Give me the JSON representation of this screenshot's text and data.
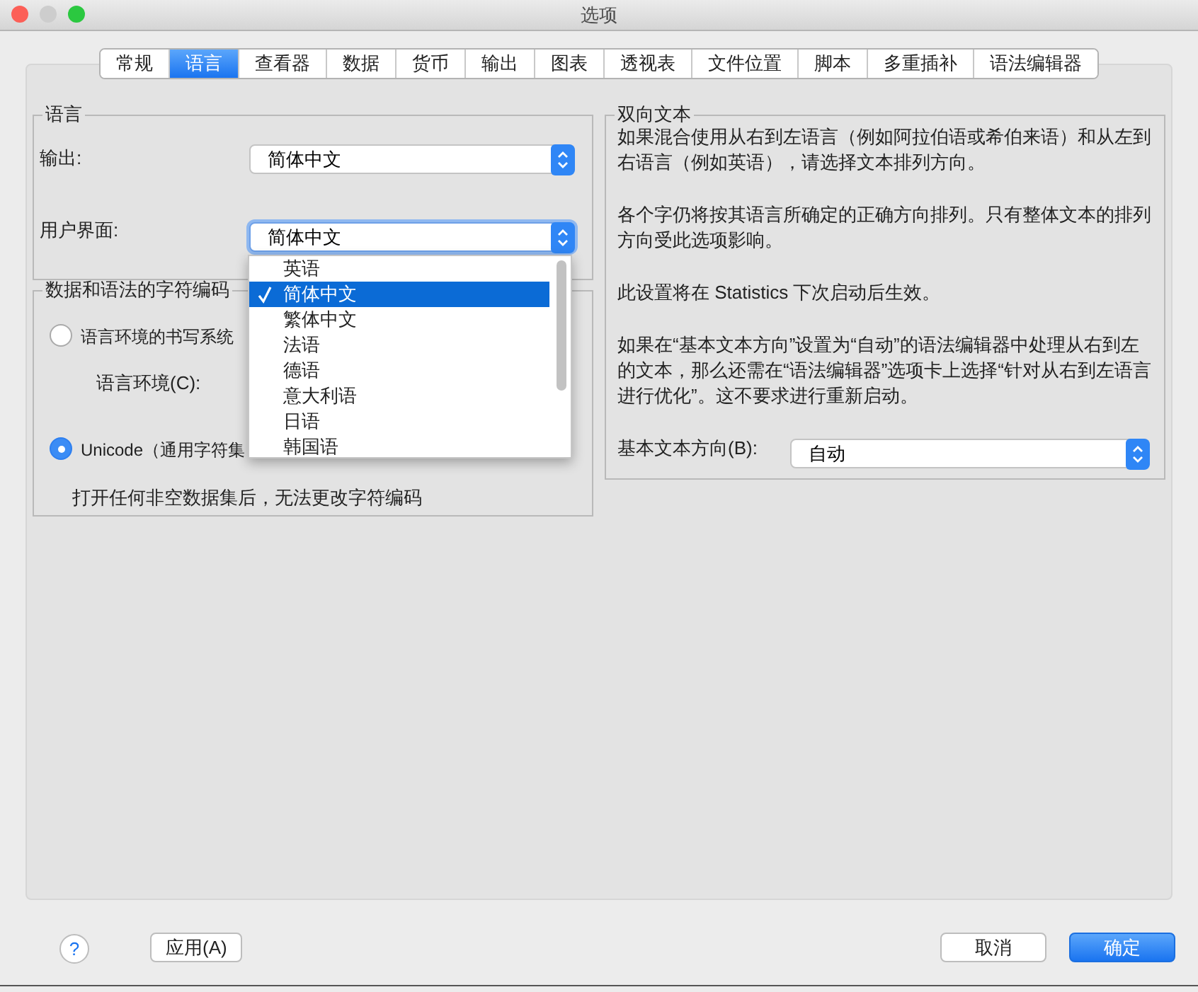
{
  "window": {
    "title": "选项"
  },
  "tabs": [
    {
      "label": "常规",
      "selected": false
    },
    {
      "label": "语言",
      "selected": true
    },
    {
      "label": "查看器",
      "selected": false
    },
    {
      "label": "数据",
      "selected": false
    },
    {
      "label": "货币",
      "selected": false
    },
    {
      "label": "输出",
      "selected": false
    },
    {
      "label": "图表",
      "selected": false
    },
    {
      "label": "透视表",
      "selected": false
    },
    {
      "label": "文件位置",
      "selected": false
    },
    {
      "label": "脚本",
      "selected": false
    },
    {
      "label": "多重插补",
      "selected": false
    },
    {
      "label": "语法编辑器",
      "selected": false
    }
  ],
  "language_group": {
    "title": "语言",
    "output": {
      "label": "输出:",
      "value": "简体中文"
    },
    "user_interface": {
      "label": "用户界面:",
      "value": "简体中文",
      "expanded": true
    }
  },
  "dropdown_items": [
    {
      "label": "英语",
      "selected": false
    },
    {
      "label": "简体中文",
      "selected": true
    },
    {
      "label": "繁体中文",
      "selected": false
    },
    {
      "label": "法语",
      "selected": false
    },
    {
      "label": "德语",
      "selected": false
    },
    {
      "label": "意大利语",
      "selected": false
    },
    {
      "label": "日语",
      "selected": false
    },
    {
      "label": "韩国语",
      "selected": false
    }
  ],
  "encoding_group": {
    "title": "数据和语法的字符编码",
    "options": [
      {
        "label": "语言环境的书写系统",
        "selected": false
      },
      {
        "label": "Unicode（通用字符集",
        "selected": true
      }
    ],
    "locale_label": "语言环境(C):",
    "note": "打开任何非空数据集后，无法更改字符编码"
  },
  "bidi_group": {
    "title": "双向文本",
    "paragraphs": [
      "如果混合使用从右到左语言（例如阿拉伯语或希伯来语）和从左到右语言（例如英语），请选择文本排列方向。",
      "各个字仍将按其语言所确定的正确方向排列。只有整体文本的排列方向受此选项影响。",
      "此设置将在 Statistics 下次启动后生效。",
      "如果在“基本文本方向”设置为“自动”的语法编辑器中处理从右到左的文本，那么还需在“语法编辑器”选项卡上选择“针对从右到左语言进行优化”。这不要求进行重新启动。"
    ],
    "direction": {
      "label": "基本文本方向(B):",
      "value": "自动"
    }
  },
  "buttons": {
    "help": "?",
    "apply": "应用(A)",
    "cancel": "取消",
    "ok": "确定"
  }
}
